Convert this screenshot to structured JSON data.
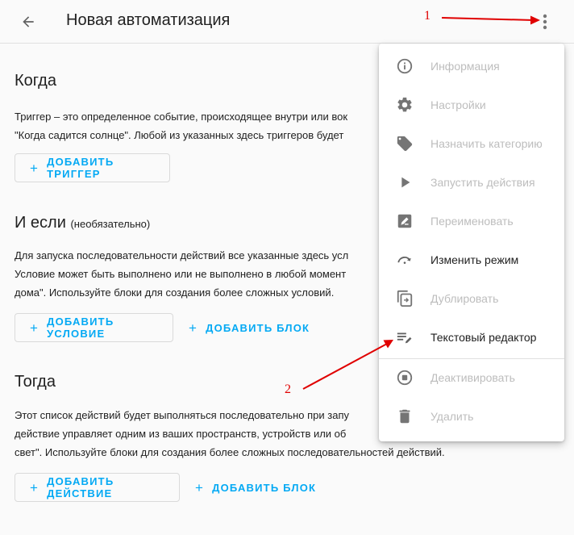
{
  "header": {
    "title": "Новая автоматизация"
  },
  "when": {
    "title": "Когда",
    "text": "Триггер – это определенное событие, происходящее внутри или вок\n\"Когда садится солнце\". Любой из указанных здесь триггеров будет",
    "add_trigger": "ДОБАВИТЬ ТРИГГЕР"
  },
  "and_if": {
    "title": "И если",
    "optional": "(необязательно)",
    "text": "Для запуска последовательности действий все указанные здесь усл\nУсловие может быть выполнено или не выполнено в любой момент\nдома\". Используйте блоки для создания более сложных условий.",
    "add_condition": "ДОБАВИТЬ УСЛОВИЕ",
    "add_block": "ДОБАВИТЬ БЛОК"
  },
  "then": {
    "title": "Тогда",
    "text": "Этот список действий будет выполняться последовательно при запу\nдействие управляет одним из ваших пространств, устройств или об\nсвет\". Используйте блоки для создания более сложных последовательностей действий.",
    "add_action": "ДОБАВИТЬ ДЕЙСТВИЕ",
    "add_block": "ДОБАВИТЬ БЛОК"
  },
  "menu": {
    "items": [
      {
        "label": "Информация",
        "icon": "info-icon",
        "enabled": false
      },
      {
        "label": "Настройки",
        "icon": "gear-icon",
        "enabled": false
      },
      {
        "label": "Назначить категорию",
        "icon": "tag-icon",
        "enabled": false
      },
      {
        "label": "Запустить действия",
        "icon": "play-icon",
        "enabled": false
      },
      {
        "label": "Переименовать",
        "icon": "rename-icon",
        "enabled": false
      },
      {
        "label": "Изменить режим",
        "icon": "redo-icon",
        "enabled": true
      },
      {
        "label": "Дублировать",
        "icon": "duplicate-icon",
        "enabled": false
      },
      {
        "label": "Текстовый редактор",
        "icon": "text-edit-icon",
        "enabled": true
      },
      {
        "label": "Деактивировать",
        "icon": "stop-circle-icon",
        "enabled": false
      },
      {
        "label": "Удалить",
        "icon": "trash-icon",
        "enabled": false
      }
    ]
  },
  "annotations": {
    "one": "1",
    "two": "2"
  },
  "colors": {
    "accent": "#03a9f4",
    "annotation": "#e00000",
    "disabled": "#bdbdbd"
  }
}
